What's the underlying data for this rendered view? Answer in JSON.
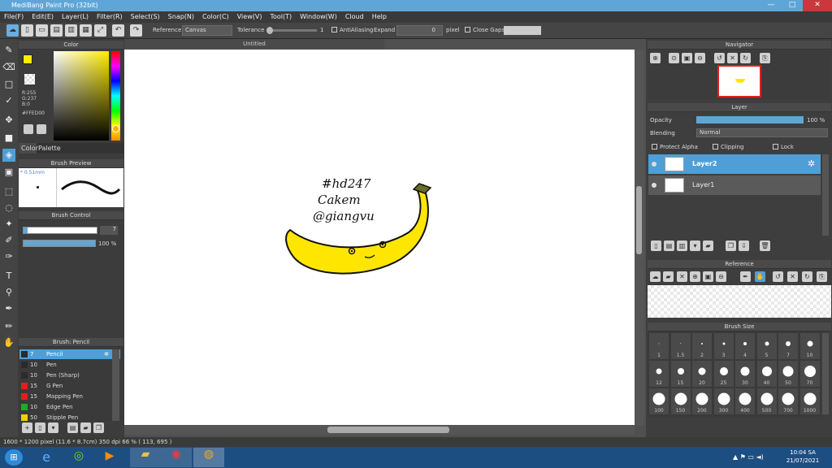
{
  "app": {
    "title": "MediBang Paint Pro (32bit)"
  },
  "window_controls": {
    "minimize": "—",
    "maximize": "□",
    "close": "✕"
  },
  "menu": [
    "File(F)",
    "Edit(E)",
    "Layer(L)",
    "Filter(R)",
    "Select(S)",
    "Snap(N)",
    "Color(C)",
    "View(V)",
    "Tool(T)",
    "Window(W)",
    "Cloud",
    "Help"
  ],
  "toolbar": {
    "reference_label": "Reference",
    "reference_value": "Canvas",
    "tolerance_label": "Tolerance",
    "tolerance_value": "1",
    "antialiasing_label": "AntiAliasing",
    "expand_label": "Expand",
    "expand_value": "0",
    "expand_unit": "pixel",
    "close_gaps_label": "Close Gaps"
  },
  "color_panel": {
    "title": "Color",
    "primary_color": "#FFED00",
    "rgb_r": "R:255",
    "rgb_g": "G:237",
    "rgb_b": "B:0",
    "hex": "#FFED00",
    "tab_color": "Color",
    "tab_palette": "Palette"
  },
  "brush_preview": {
    "title": "Brush Preview",
    "size_label": "* 0.51mm"
  },
  "brush_control": {
    "title": "Brush Control",
    "size_value": "7",
    "opacity_value": "100 %",
    "size_fraction": 0.05,
    "opacity_fraction": 1.0
  },
  "brush_list": {
    "title": "Brush: Pencil",
    "items": [
      {
        "size": "7",
        "name": "Pencil",
        "color": "#2b2b2b",
        "selected": true
      },
      {
        "size": "10",
        "name": "Pen",
        "color": "#2b2b2b"
      },
      {
        "size": "10",
        "name": "Pen (Sharp)",
        "color": "#2b2b2b"
      },
      {
        "size": "15",
        "name": "G Pen",
        "color": "#e02020"
      },
      {
        "size": "15",
        "name": "Mapping Pen",
        "color": "#e02020"
      },
      {
        "size": "10",
        "name": "Edge Pen",
        "color": "#22aa22"
      },
      {
        "size": "50",
        "name": "Stipple Pen",
        "color": "#f0d000"
      }
    ]
  },
  "canvas": {
    "tab_title": "Untitled",
    "handwriting": [
      "#hd247",
      "Cakem",
      "@giangvu"
    ]
  },
  "navigator": {
    "title": "Navigator"
  },
  "layer_panel": {
    "title": "Layer",
    "opacity_label": "Opacity",
    "opacity_value": "100 %",
    "opacity_fraction": 1.0,
    "blending_label": "Blending",
    "blending_value": "Normal",
    "protect_alpha": "Protect Alpha",
    "clipping": "Clipping",
    "lock": "Lock",
    "layers": [
      {
        "name": "Layer2",
        "selected": true
      },
      {
        "name": "Layer1",
        "selected": false
      }
    ]
  },
  "reference_panel": {
    "title": "Reference"
  },
  "brush_size_panel": {
    "title": "Brush Size",
    "row1": [
      "1",
      "1.5",
      "2",
      "3",
      "4",
      "5",
      "7",
      "10"
    ],
    "row2": [
      "12",
      "15",
      "20",
      "25",
      "30",
      "40",
      "50",
      "70"
    ],
    "row3": [
      "100",
      "150",
      "200",
      "300",
      "400",
      "500",
      "700",
      "1000"
    ]
  },
  "status": {
    "text": "1600 * 1200 pixel   (11.6 * 8.7cm)   350 dpi   66 %   ( 113, 695 )"
  },
  "taskbar": {
    "time": "10:04 SA",
    "date": "21/07/2021"
  },
  "colors": {
    "accent": "#4f9fd6",
    "banana": "#ffe600"
  }
}
